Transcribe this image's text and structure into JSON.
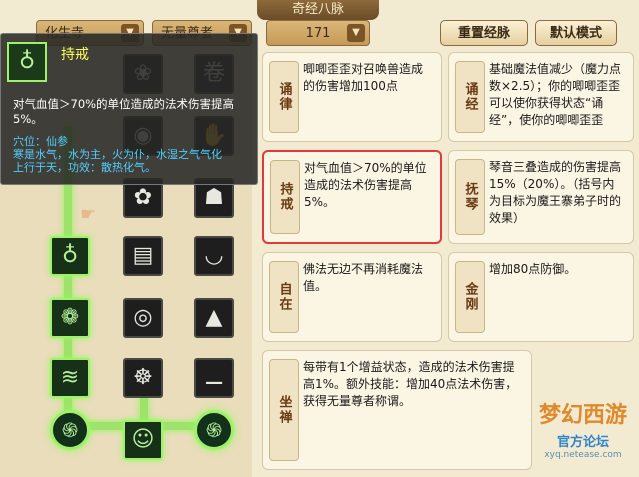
{
  "window": {
    "title": "奇经八脉"
  },
  "toolbar": {
    "school_select": "化生寺",
    "title_select": "无量尊者",
    "points_value": "171",
    "reset_label": "重置经脉",
    "default_label": "默认模式"
  },
  "tooltip": {
    "name": "持戒",
    "description": "对气血值＞70%的单位造成的法术伤害提高5%。",
    "extra_lines": [
      "穴位：仙参",
      "寒是水气，水为主，火为仆，水湿之气气化",
      "上行于天，功效：散热化气。"
    ]
  },
  "cards": [
    {
      "tag": "诵律",
      "text": "唧唧歪歪对召唤兽造成的伤害增加100点"
    },
    {
      "tag": "诵经",
      "text": "基础魔法值减少（魔力点数×2.5）；你的唧唧歪歪可以使你获得状态“诵经”，使你的唧唧歪歪"
    },
    {
      "tag": "持戒",
      "text": "对气血值＞70%的单位造成的法术伤害提高5%。"
    },
    {
      "tag": "抚琴",
      "text": "琴音三叠造成的伤害提高15%（20%）。（括号内为目标为魔王寨弟子时的效果）"
    },
    {
      "tag": "自在",
      "text": "佛法无边不再消耗魔法值。"
    },
    {
      "tag": "金刚",
      "text": "增加80点防御。"
    },
    {
      "tag": "坐禅",
      "text": "每带有1个增益状态，造成的法术伤害提高1%。额外技能：增加40点法术伤害，获得无量尊者称谓。"
    }
  ],
  "tree_icons": {
    "row1": [
      "bud-icon",
      "monk-figure-icon",
      "scroll-icon"
    ],
    "row2": [
      "eye-icon",
      "hand-icon"
    ],
    "row3": [
      "flower-icon",
      "meditating-monk-icon"
    ],
    "row4": [
      "bottle-icon",
      "book-stack-icon",
      "bowl-icon"
    ],
    "row5": [
      "lotus-icon",
      "aura-icon",
      "pagoda-icon"
    ],
    "row6": [
      "wave-icon",
      "seated-buddha-icon",
      "dash-icon"
    ],
    "row7": [
      "swirl-icon",
      "figure-icon",
      "swirl-icon"
    ]
  },
  "watermark": {
    "logo": "梦幻西游",
    "sub": "官方论坛",
    "url": "xyq.netease.com"
  }
}
